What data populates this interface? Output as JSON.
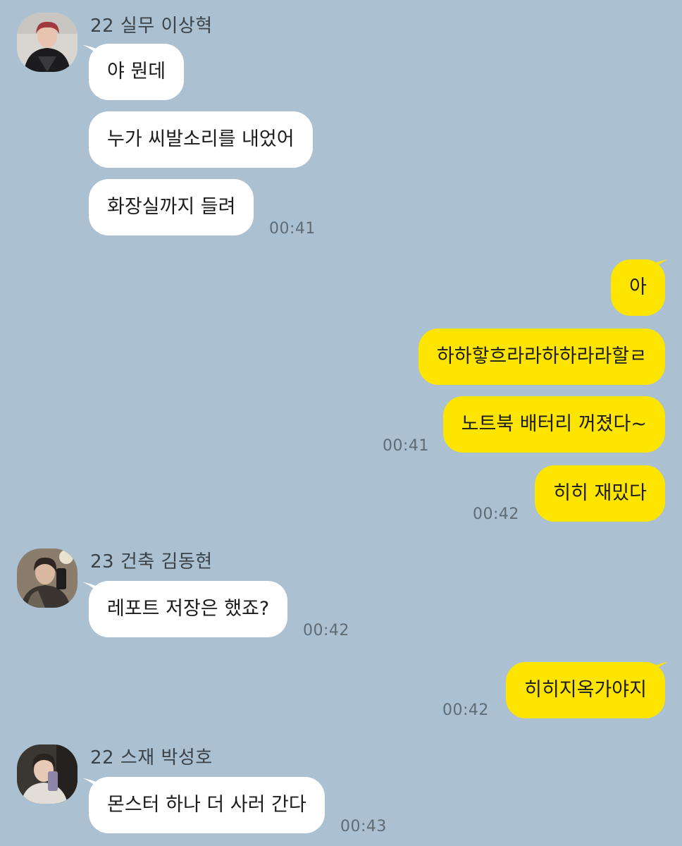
{
  "senders": {
    "s1": "22 실무 이상혁",
    "s2": "23 건축 김동현",
    "s3": "22 스재 박성호"
  },
  "messages": {
    "m1": "야 뭔데",
    "m2": "누가 씨발소리를 내었어",
    "m3": "화장실까지 들려",
    "m4": "아",
    "m5": "하하핳흐라라하하라라할ㄹ",
    "m6": "노트북 배터리 꺼졌다~",
    "m7": "히히 재밌다",
    "m8": "레포트 저장은 했죠?",
    "m9": "히히지옥가야지",
    "m10": "몬스터 하나 더 사러 간다"
  },
  "times": {
    "t1": "00:41",
    "t2": "00:41",
    "t3": "00:42",
    "t4": "00:42",
    "t5": "00:42",
    "t6": "00:43"
  },
  "colors": {
    "background": "#abc1d1",
    "incoming_bubble": "#ffffff",
    "outgoing_bubble": "#fee500"
  }
}
